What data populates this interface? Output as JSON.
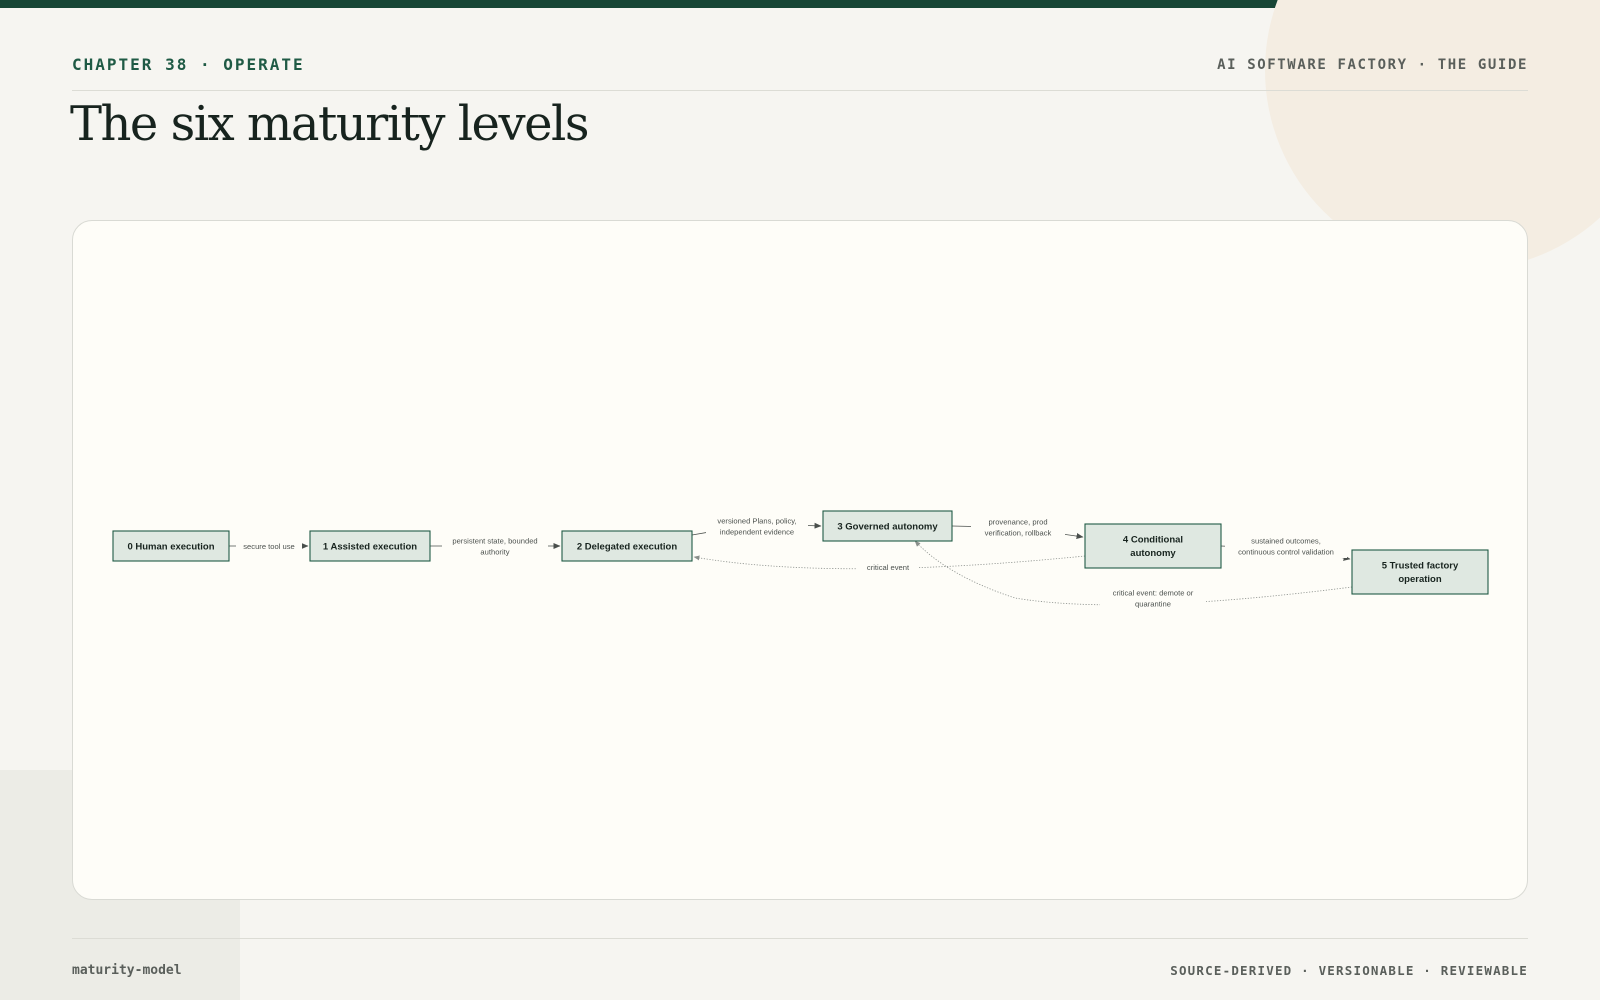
{
  "header": {
    "eyebrow": "CHAPTER 38 · OPERATE",
    "brand": "AI SOFTWARE FACTORY · THE GUIDE",
    "title": "The six maturity levels"
  },
  "footer": {
    "slug": "maturity-model",
    "tagline": "SOURCE-DERIVED · VERSIONABLE · REVIEWABLE"
  },
  "colors": {
    "accent": "#174636",
    "node_fill": "#dfe8e1",
    "node_stroke": "#1f5a45",
    "background": "#f6f5f1",
    "card": "#fefdf8"
  },
  "diagram": {
    "type": "flowchart",
    "nodes": [
      {
        "id": "L0",
        "lines": [
          "0 Human execution"
        ]
      },
      {
        "id": "L1",
        "lines": [
          "1 Assisted execution"
        ]
      },
      {
        "id": "L2",
        "lines": [
          "2 Delegated execution"
        ]
      },
      {
        "id": "L3",
        "lines": [
          "3 Governed autonomy"
        ]
      },
      {
        "id": "L4",
        "lines": [
          "4 Conditional",
          "autonomy"
        ]
      },
      {
        "id": "L5",
        "lines": [
          "5 Trusted factory",
          "operation"
        ]
      }
    ],
    "edges": [
      {
        "from": "L0",
        "to": "L1",
        "style": "solid",
        "label": [
          "secure tool use"
        ]
      },
      {
        "from": "L1",
        "to": "L2",
        "style": "solid",
        "label": [
          "persistent state, bounded",
          "authority"
        ]
      },
      {
        "from": "L2",
        "to": "L3",
        "style": "solid",
        "label": [
          "versioned Plans, policy,",
          "independent evidence"
        ]
      },
      {
        "from": "L3",
        "to": "L4",
        "style": "solid",
        "label": [
          "provenance, prod",
          "verification, rollback"
        ]
      },
      {
        "from": "L4",
        "to": "L5",
        "style": "solid",
        "label": [
          "sustained outcomes,",
          "continuous control validation"
        ]
      },
      {
        "from": "L4",
        "to": "L2",
        "style": "dotted",
        "label": [
          "critical event"
        ]
      },
      {
        "from": "L5",
        "to": "L3",
        "style": "dotted",
        "label": [
          "critical event: demote or",
          "quarantine"
        ]
      }
    ]
  }
}
